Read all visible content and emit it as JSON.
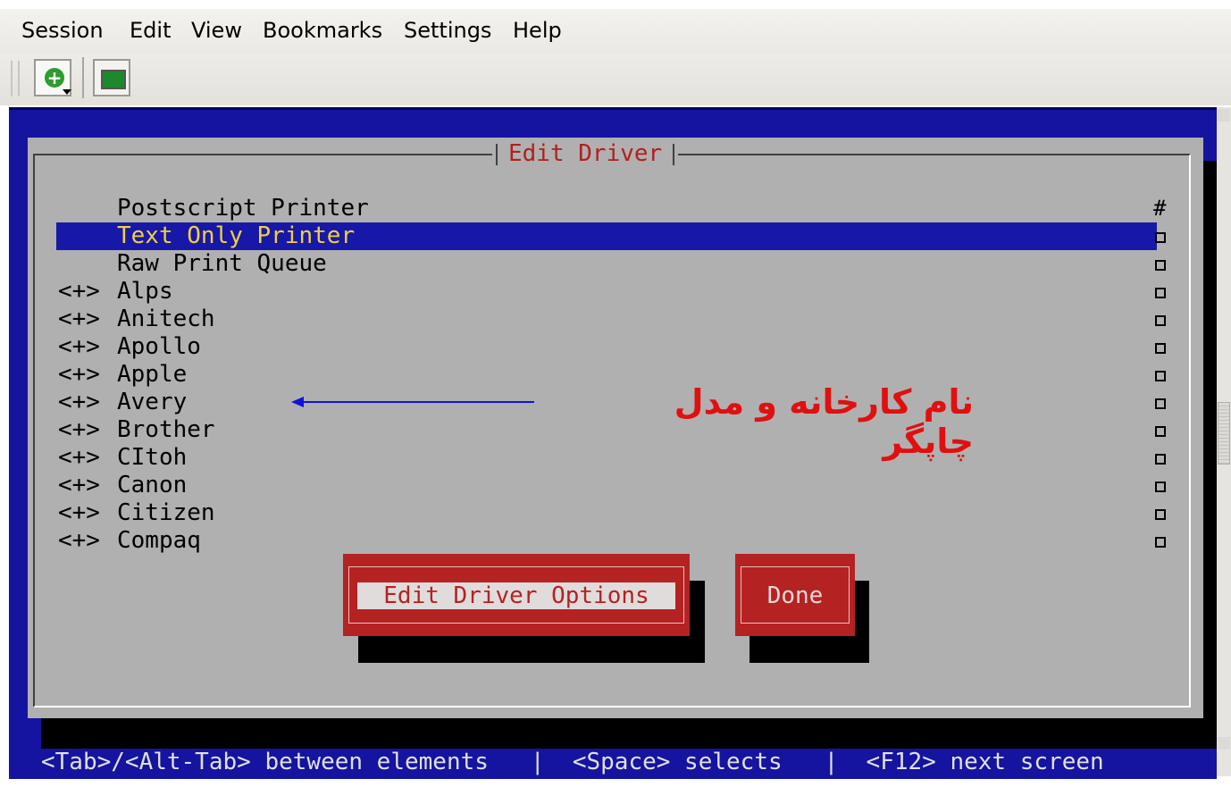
{
  "menubar": {
    "items": [
      "Session",
      "Edit",
      "View",
      "Bookmarks",
      "Settings",
      "Help"
    ]
  },
  "toolbar": {
    "new_session_icon": "new-session-icon",
    "terminal_icon": "terminal-icon"
  },
  "dialog": {
    "title": "Edit Driver",
    "column_marker": "#",
    "drivers": [
      {
        "prefix": "",
        "label": "Postscript Printer",
        "checkbox": false
      },
      {
        "prefix": "",
        "label": "Text Only Printer",
        "selected": true,
        "checkbox": true
      },
      {
        "prefix": "",
        "label": "Raw Print Queue",
        "checkbox": true
      },
      {
        "prefix": "<+>",
        "label": "Alps",
        "checkbox": true
      },
      {
        "prefix": "<+>",
        "label": "Anitech",
        "checkbox": true
      },
      {
        "prefix": "<+>",
        "label": "Apollo",
        "checkbox": true
      },
      {
        "prefix": "<+>",
        "label": "Apple",
        "checkbox": true
      },
      {
        "prefix": "<+>",
        "label": "Avery",
        "checkbox": true
      },
      {
        "prefix": "<+>",
        "label": "Brother",
        "checkbox": true
      },
      {
        "prefix": "<+>",
        "label": "CItoh",
        "checkbox": true
      },
      {
        "prefix": "<+>",
        "label": "Canon",
        "checkbox": true
      },
      {
        "prefix": "<+>",
        "label": "Citizen",
        "checkbox": true
      },
      {
        "prefix": "<+>",
        "label": "Compaq",
        "checkbox": true
      }
    ],
    "buttons": {
      "edit_options": "Edit Driver Options",
      "done": "Done"
    }
  },
  "annotation": {
    "text": "نام کارخانه و مدل چاپگر"
  },
  "status_bar": {
    "text": "<Tab>/<Alt-Tab> between elements   |  <Space> selects   |  <F12> next screen"
  },
  "colors": {
    "terminal_bg": "#1414a0",
    "dialog_bg": "#b0b0b0",
    "selected_bg": "#1818a8",
    "selected_fg": "#f0d040",
    "button_bg": "#b52222",
    "title_fg": "#b02020",
    "annotation_fg": "#e01010",
    "arrow": "#1010e0"
  }
}
